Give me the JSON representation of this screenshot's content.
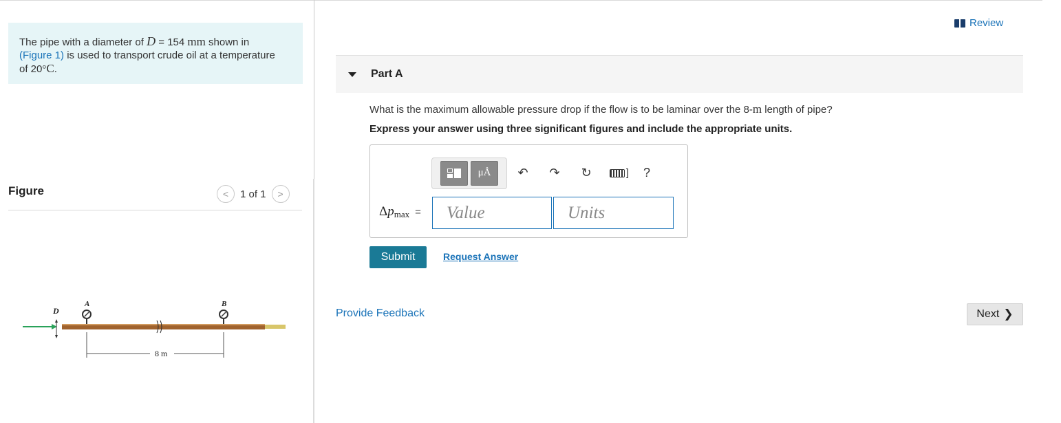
{
  "problem": {
    "text_1": "The pipe with a diameter of ",
    "var_D": "D",
    "text_2": " = 154 ",
    "unit_mm": "mm",
    "text_3": " shown in",
    "figure_link": "(Figure 1)",
    "text_4": " is used to transport crude oil at a temperature",
    "text_5": "of 20",
    "degree": "°",
    "unit_C": "C",
    "period": "."
  },
  "figure_panel": {
    "label": "Figure",
    "pager_text": "1 of 1",
    "prev_glyph": "<",
    "next_glyph": ">",
    "labels": {
      "D": "D",
      "A": "A",
      "B": "B",
      "length": "8 m"
    }
  },
  "review": {
    "label": "Review"
  },
  "part": {
    "title": "Part A"
  },
  "question": {
    "text_before": "What is the maximum allowable pressure drop if the flow is to be laminar over the 8-",
    "unit_m": "m",
    "text_after": " length of pipe?",
    "instruction": "Express your answer using three significant figures and include the appropriate units."
  },
  "answer": {
    "toolbar": {
      "units_button": "μÅ",
      "help": "?",
      "undo_glyph": "↶",
      "redo_glyph": "↷",
      "reset_glyph": "↻",
      "keyboard_suffix": "]"
    },
    "label_delta": "Δ",
    "label_p": "p",
    "label_sub": "max",
    "label_eq": "=",
    "value_placeholder": "Value",
    "units_placeholder": "Units"
  },
  "actions": {
    "submit": "Submit",
    "request_answer": "Request Answer",
    "provide_feedback": "Provide Feedback",
    "next": "Next",
    "next_glyph": "❯"
  },
  "colors": {
    "accent_blue": "#1a73b8",
    "submit_bg": "#1a7a96",
    "problem_bg": "#e6f5f7",
    "pipe": "#a0632e"
  }
}
